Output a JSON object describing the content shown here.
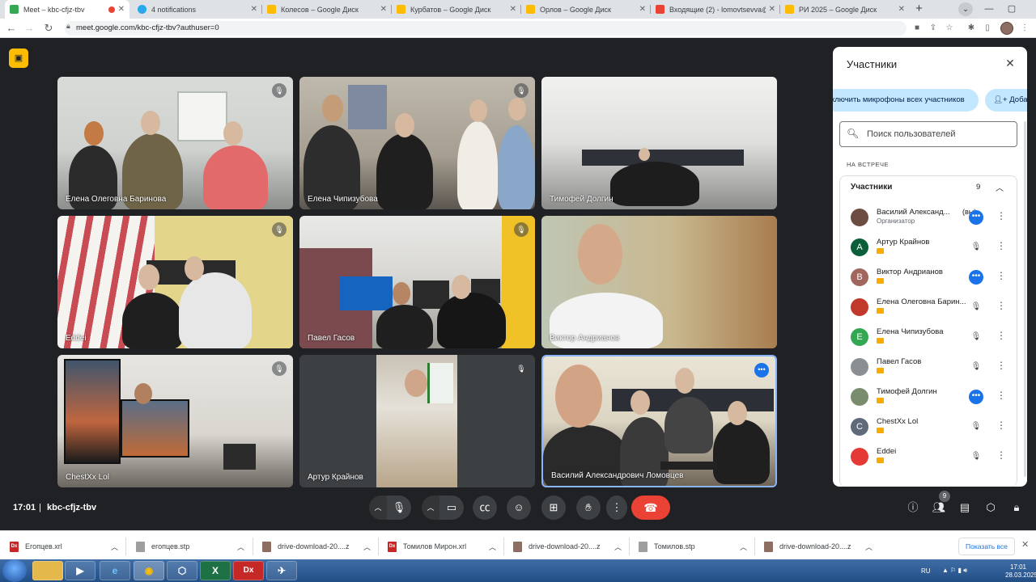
{
  "browser": {
    "tabs": [
      {
        "title": "Meet – kbc-cfjz-tbv",
        "color": "#34a853",
        "active": true
      },
      {
        "title": "4 notifications",
        "color": "#29a9eb"
      },
      {
        "title": "Колесов – Google Диск",
        "color": "#fbbc04"
      },
      {
        "title": "Курбатов – Google Диск",
        "color": "#fbbc04"
      },
      {
        "title": "Орлов – Google Диск",
        "color": "#fbbc04"
      },
      {
        "title": "Входящие (2) - lomovtsevva@cta",
        "color": "#ea4335"
      },
      {
        "title": "РИ 2025 – Google Диск",
        "color": "#fbbc04"
      }
    ],
    "url": "meet.google.com/kbc-cfjz-tbv?authuser=0"
  },
  "meeting": {
    "tiles": [
      {
        "name": "Елена Олеговна Баринова",
        "state": "muted"
      },
      {
        "name": "Елена Чипизубова",
        "state": "muted"
      },
      {
        "name": "Тимофей Долгин",
        "state": "none"
      },
      {
        "name": "Eddei",
        "state": "muted"
      },
      {
        "name": "Павел Гасов",
        "state": "muted"
      },
      {
        "name": "Виктор Андрианов",
        "state": "none"
      },
      {
        "name": "ChestXx Lol",
        "state": "muted"
      },
      {
        "name": "Артур Крайнов",
        "state": "muted"
      },
      {
        "name": "Василий Александрович Ломовцев",
        "state": "talking"
      }
    ],
    "time": "17:01",
    "code": "kbc-cfjz-tbv",
    "participant_count": "9"
  },
  "panel": {
    "title": "Участники",
    "mute_all": "ключить микрофоны всех участников",
    "add_people": "Доба",
    "search_placeholder": "Поиск пользователей",
    "section_label": "НА ВСТРЕЧЕ",
    "group_label": "Участники",
    "group_count": "9",
    "participants": [
      {
        "name": "Василий Александ...",
        "you": "(вы)",
        "role": "Организатор",
        "avatar": "",
        "avatar_color": "#6d4c41",
        "state": "talking"
      },
      {
        "name": "Артур Крайнов",
        "avatar": "А",
        "avatar_color": "#0b5e3a",
        "state": "muted"
      },
      {
        "name": "Виктор Андрианов",
        "avatar": "В",
        "avatar_color": "#a1665e",
        "state": "talking"
      },
      {
        "name": "Елена Олеговна Барин...",
        "avatar": "",
        "avatar_color": "#c0392b",
        "state": "muted"
      },
      {
        "name": "Елена Чипизубова",
        "avatar": "Е",
        "avatar_color": "#33a852",
        "state": "muted"
      },
      {
        "name": "Павел Гасов",
        "avatar": "",
        "avatar_color": "#8a8f94",
        "state": "muted"
      },
      {
        "name": "Тимофей Долгин",
        "avatar": "",
        "avatar_color": "#7a8c6e",
        "state": "talking"
      },
      {
        "name": "ChestXx Lol",
        "avatar": "C",
        "avatar_color": "#5f6b7a",
        "state": "muted"
      },
      {
        "name": "Eddei",
        "avatar": "",
        "avatar_color": "#e53935",
        "state": "muted"
      }
    ]
  },
  "downloads": {
    "items": [
      {
        "name": "Егопцев.xrl",
        "icon": "Dx",
        "color": "#c62828"
      },
      {
        "name": "егопцев.stp",
        "icon": "",
        "color": "#9e9e9e"
      },
      {
        "name": "drive-download-20....zip",
        "icon": "",
        "color": "#8d6e63"
      },
      {
        "name": "Томилов Мирон.xrl",
        "icon": "Dx",
        "color": "#c62828"
      },
      {
        "name": "drive-download-20....zip",
        "icon": "",
        "color": "#8d6e63"
      },
      {
        "name": "Томилов.stp",
        "icon": "",
        "color": "#9e9e9e"
      },
      {
        "name": "drive-download-20....zip",
        "icon": "",
        "color": "#8d6e63"
      }
    ],
    "show_all": "Показать все"
  },
  "taskbar": {
    "apps": [
      "▶",
      "e",
      "◉",
      "⬡",
      "X",
      "Dx",
      "✈"
    ],
    "lang": "RU",
    "time": "17:01",
    "date": "28.03.2025"
  }
}
